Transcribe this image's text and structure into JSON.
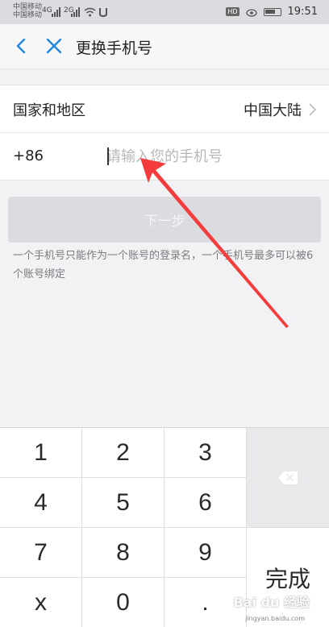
{
  "status_bar": {
    "carrier_1": "中国移动",
    "carrier_2": "中国移动",
    "signal_1": "4G",
    "signal_2": "2G",
    "hd": "HD",
    "time": "19:51"
  },
  "nav": {
    "title": "更换手机号"
  },
  "form": {
    "region_label": "国家和地区",
    "region_value": "中国大陆",
    "country_code": "+86",
    "phone_placeholder": "请输入您的手机号",
    "phone_value": ""
  },
  "next_button": {
    "label": "下一步"
  },
  "hint": "一个手机号只能作为一个账号的登录名，一个手机号最多可以被6个账号绑定",
  "keyboard": {
    "keys": [
      "1",
      "2",
      "3",
      "4",
      "5",
      "6",
      "7",
      "8",
      "9",
      "x",
      "0",
      "."
    ],
    "done_label": "完成"
  },
  "watermark": {
    "text": "Bai du 经验",
    "sub": "jingyan.baidu.com"
  },
  "colors": {
    "accent": "#1e88e5",
    "arrow": "#f43c3c",
    "button_disabled": "#dcdce0"
  }
}
